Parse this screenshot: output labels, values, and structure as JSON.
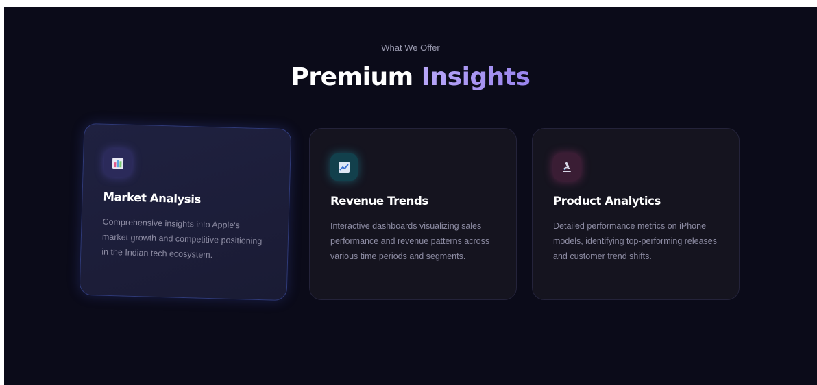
{
  "section": {
    "eyebrow": "What We Offer",
    "title_main": "Premium",
    "title_accent": "Insights"
  },
  "cards": [
    {
      "title": "Market Analysis",
      "description": "Comprehensive insights into Apple's market growth and competitive positioning in the Indian tech ecosystem.",
      "icon": "bar-chart-icon",
      "accent": "#6b63e6"
    },
    {
      "title": "Revenue Trends",
      "description": "Interactive dashboards visualizing sales performance and revenue patterns across various time periods and segments.",
      "icon": "line-chart-icon",
      "accent": "#2ab0c2"
    },
    {
      "title": "Product Analytics",
      "description": "Detailed performance metrics on iPhone models, identifying top-performing releases and customer trend shifts.",
      "icon": "microscope-icon",
      "accent": "#c8468c"
    }
  ],
  "colors": {
    "background": "#0b0b19",
    "card": "#15141f",
    "heading_accent": "#a794f2"
  }
}
